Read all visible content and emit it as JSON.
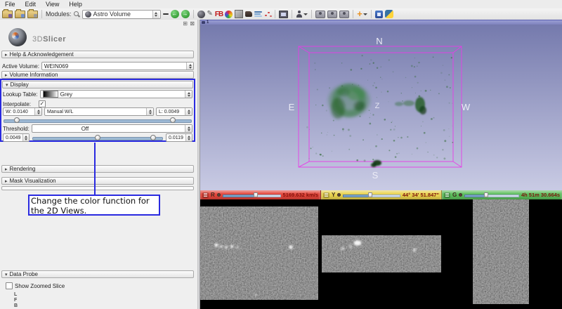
{
  "menu": {
    "items": [
      "File",
      "Edit",
      "View",
      "Help"
    ]
  },
  "toolbar": {
    "modules_label": "Modules:",
    "module_selector_value": "Astro Volume",
    "fb_icon_label": "FB"
  },
  "panel": {
    "logo_prefix": "3D",
    "logo_suffix": "Slicer",
    "help_section": "Help & Acknowledgement",
    "active_volume_label": "Active Volume:",
    "active_volume_value": "WEIN069",
    "volume_information_section": "Volume Information",
    "rendering_section": "Rendering",
    "mask_visualization_section": "Mask Visualization",
    "data_probe_section": "Data Probe",
    "show_zoomed_slice_label": "Show Zoomed Slice",
    "probe_rows": [
      "L",
      "F",
      "B"
    ]
  },
  "display": {
    "section": "Display",
    "lookup_table_label": "Lookup Table:",
    "lookup_table_value": "Grey",
    "interpolate_label": "Interpolate:",
    "window_value": "W: 0.0140",
    "wl_mode": "Manual W/L",
    "level_value": "L: 0.0049",
    "threshold_label": "Threshold:",
    "threshold_mode": "Off",
    "threshold_min": "0.0049",
    "threshold_max": "0.0119"
  },
  "annotation": {
    "line1": "Change the color function for",
    "line2": "the 2D Views."
  },
  "view3d": {
    "view_label": "1",
    "orientation": {
      "n": "N",
      "s": "S",
      "e": "E",
      "w": "W",
      "z": "Z"
    },
    "box_color": "#e83ce8",
    "background_top": "#757aad",
    "background_bottom": "#c9cbe4"
  },
  "slice_views": [
    {
      "name": "Red",
      "letter": "R",
      "value": "5169.632 km/s",
      "color": "#e2453a"
    },
    {
      "name": "Yellow",
      "letter": "Y",
      "value": "44° 34' 51.847\"",
      "color": "#e8d24e"
    },
    {
      "name": "Green",
      "letter": "G",
      "value": "4h 51m 30.664s",
      "color": "#5cbd5c"
    }
  ]
}
